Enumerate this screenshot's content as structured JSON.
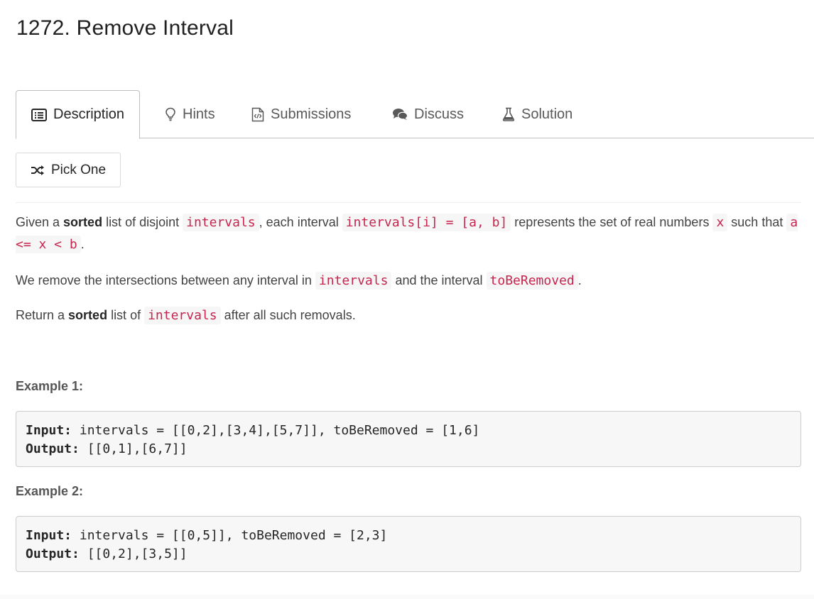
{
  "problem": {
    "title": "1272. Remove Interval"
  },
  "tabs": [
    {
      "label": "Description",
      "icon": "list-icon",
      "active": true
    },
    {
      "label": "Hints",
      "icon": "lightbulb-icon",
      "active": false
    },
    {
      "label": "Submissions",
      "icon": "code-file-icon",
      "active": false
    },
    {
      "label": "Discuss",
      "icon": "chat-bubbles-icon",
      "active": false
    },
    {
      "label": "Solution",
      "icon": "flask-icon",
      "active": false
    }
  ],
  "pick_one": {
    "label": "Pick One",
    "icon": "shuffle-icon"
  },
  "description": {
    "p1": {
      "t1": "Given a ",
      "b1": "sorted",
      "t2": " list of disjoint ",
      "c1": "intervals",
      "t3": ", each interval ",
      "c2": "intervals[i] = [a, b]",
      "t4": " represents the set of real numbers ",
      "c3": "x",
      "t5": " such that ",
      "c4": "a <= x < b",
      "t6": "."
    },
    "p2": {
      "t1": "We remove the intersections between any interval in ",
      "c1": "intervals",
      "t2": " and the interval ",
      "c2": "toBeRemoved",
      "t3": "."
    },
    "p3": {
      "t1": "Return a ",
      "b1": "sorted",
      "t2": " list of ",
      "c1": "intervals",
      "t3": " after all such removals."
    }
  },
  "examples": [
    {
      "title": "Example 1:",
      "input_label": "Input:",
      "input": " intervals = [[0,2],[3,4],[5,7]], toBeRemoved = [1,6]",
      "output_label": "Output:",
      "output": " [[0,1],[6,7]]"
    },
    {
      "title": "Example 2:",
      "input_label": "Input:",
      "input": " intervals = [[0,5]], toBeRemoved = [2,3]",
      "output_label": "Output:",
      "output": " [[0,2],[3,5]]"
    }
  ],
  "colors": {
    "inline_code": "#c7254e",
    "inline_code_bg": "#f6f6f6",
    "pre_bg": "#f7f7f7",
    "tab_border": "#bfbfbf"
  }
}
